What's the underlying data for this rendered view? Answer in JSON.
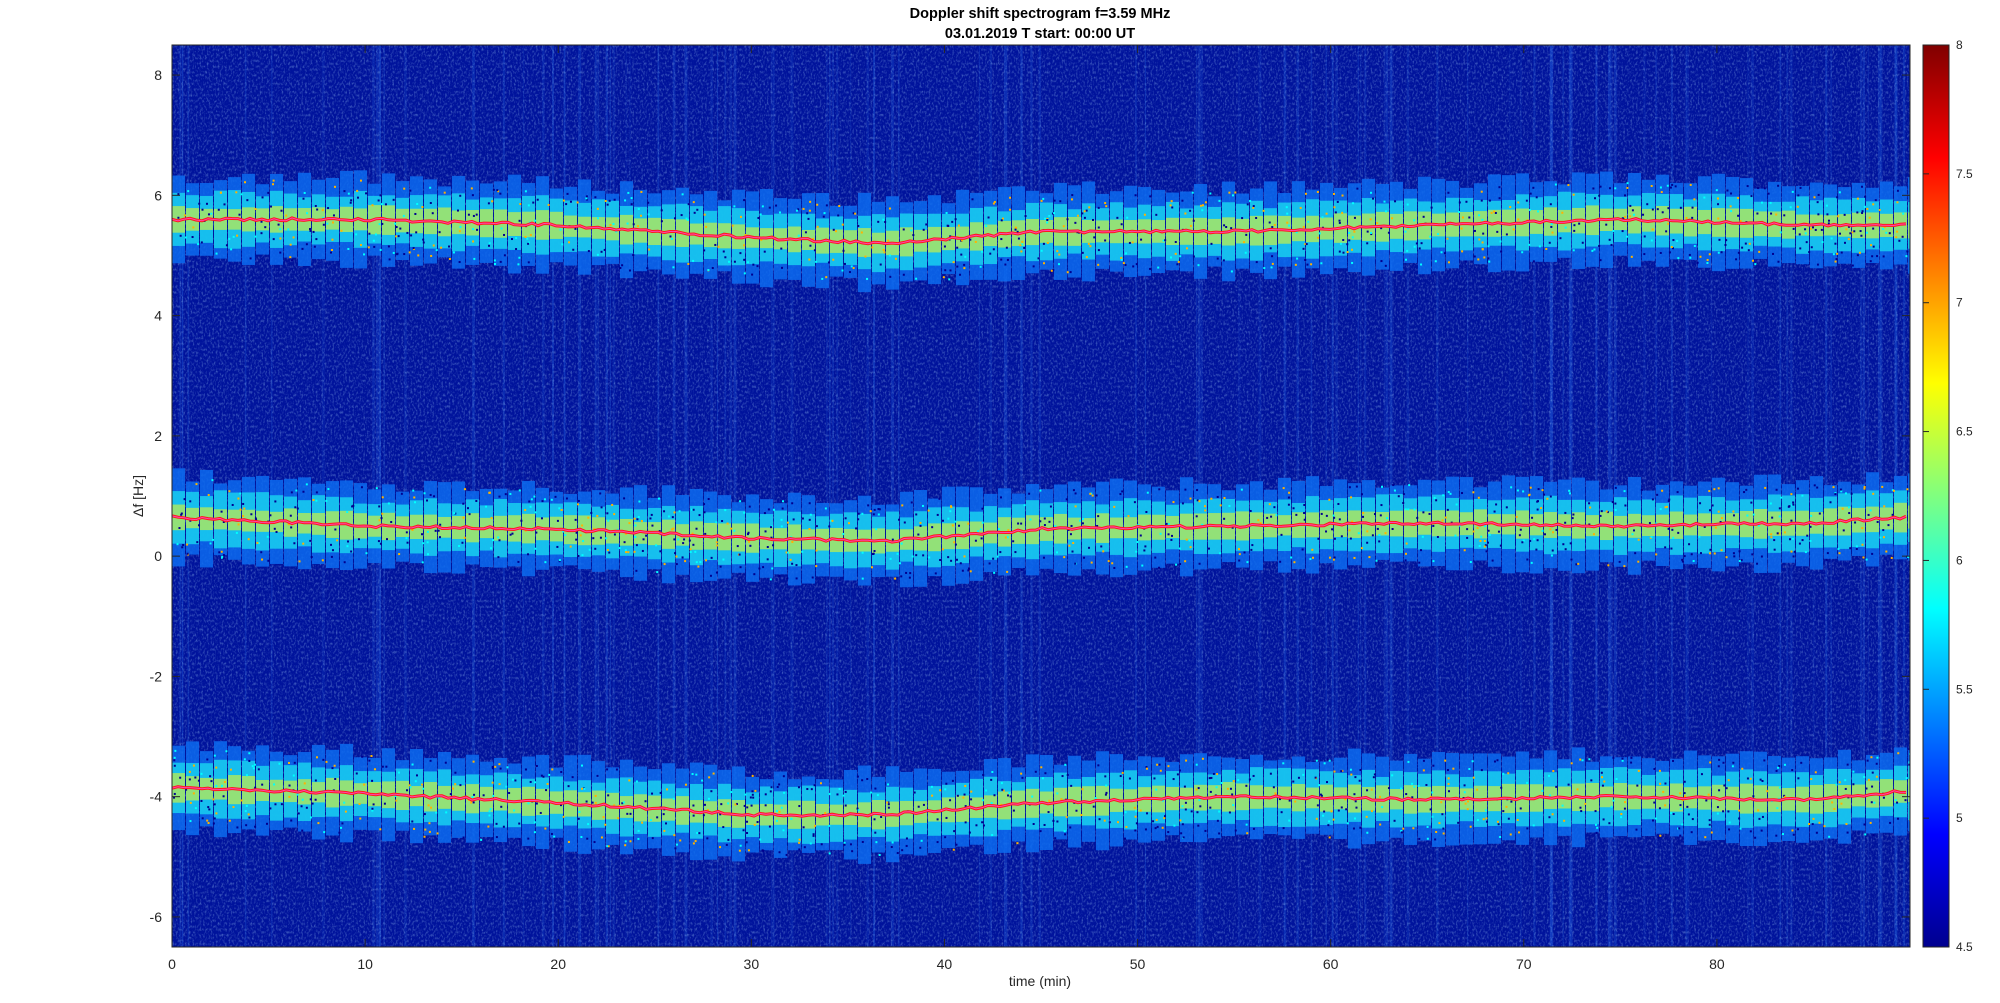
{
  "chart_data": {
    "type": "heatmap",
    "title": "Doppler shift spectrogram f=3.59 MHz",
    "subtitle": "03.01.2019   T start: 00:00 UT",
    "xlabel": "time (min)",
    "ylabel": "Δf [Hz]",
    "xlim": [
      0,
      90
    ],
    "ylim": [
      -6.5,
      8.5
    ],
    "xticks": [
      "0",
      "10",
      "20",
      "30",
      "40",
      "50",
      "60",
      "70",
      "80"
    ],
    "yticks": [
      "-6",
      "-4",
      "-2",
      "0",
      "2",
      "4",
      "6",
      "8"
    ],
    "colorbar": {
      "colormap": "jet",
      "range": [
        4.5,
        8
      ],
      "ticks": [
        "4.5",
        "5",
        "5.5",
        "6",
        "6.5",
        "7",
        "7.5",
        "8"
      ]
    },
    "series": [
      {
        "x": [
          0,
          10,
          20,
          30,
          37,
          45,
          55,
          65,
          75,
          85,
          90
        ],
        "y": [
          5.6,
          5.6,
          5.5,
          5.3,
          5.2,
          5.4,
          5.4,
          5.5,
          5.6,
          5.5,
          5.5
        ]
      },
      {
        "x": [
          0,
          10,
          20,
          30,
          37,
          45,
          55,
          65,
          75,
          85,
          90
        ],
        "y": [
          0.65,
          0.5,
          0.45,
          0.3,
          0.25,
          0.45,
          0.5,
          0.55,
          0.5,
          0.55,
          0.65
        ]
      },
      {
        "x": [
          0,
          10,
          20,
          30,
          37,
          45,
          55,
          65,
          75,
          85,
          90
        ],
        "y": [
          -3.85,
          -3.95,
          -4.1,
          -4.3,
          -4.3,
          -4.1,
          -4.0,
          -4.05,
          -4.0,
          -4.05,
          -3.9
        ]
      }
    ]
  }
}
